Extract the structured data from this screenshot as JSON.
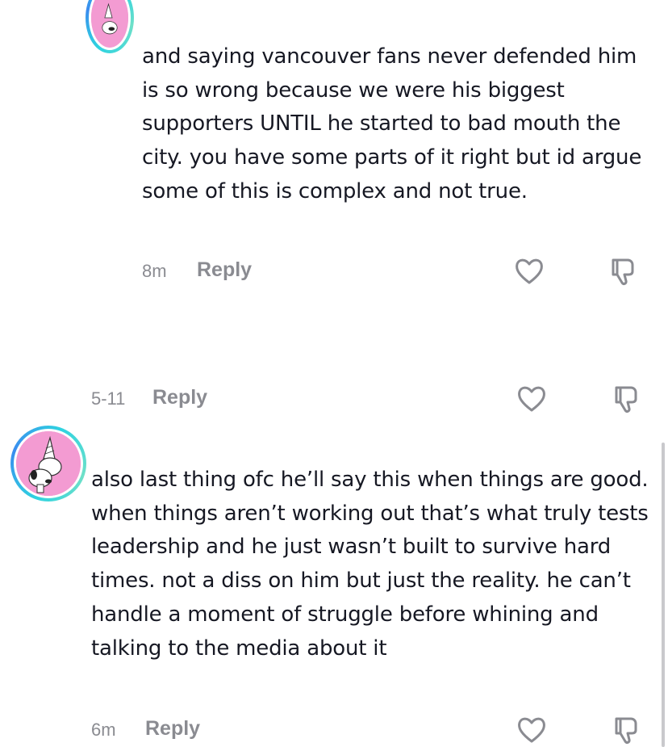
{
  "comments": [
    {
      "text": "and saying vancouver fans never defended him is so wrong because we were his biggest supporters UNTIL he started to bad mouth the city. you have some parts of it right but id argue some of this is complex and not true.",
      "time": "8m",
      "reply_label": "Reply"
    },
    {
      "time": "5-11",
      "reply_label": "Reply"
    },
    {
      "text": "also last thing ofc he’ll say this when things are good. when things aren’t working out that’s what truly tests leadership and he just wasn’t built to survive hard times. not a diss on him but just the reality. he can’t handle a moment of struggle before whining and talking to the media about it",
      "time": "6m",
      "reply_label": "Reply"
    }
  ],
  "icons": {
    "like": "heart-outline-icon",
    "dislike": "thumbs-down-outline-icon"
  },
  "colors": {
    "avatar_bg": "#f39bd2",
    "avatar_ring": "#2fd3e0",
    "meta_text": "#8a8b91",
    "body_text": "#161823"
  }
}
